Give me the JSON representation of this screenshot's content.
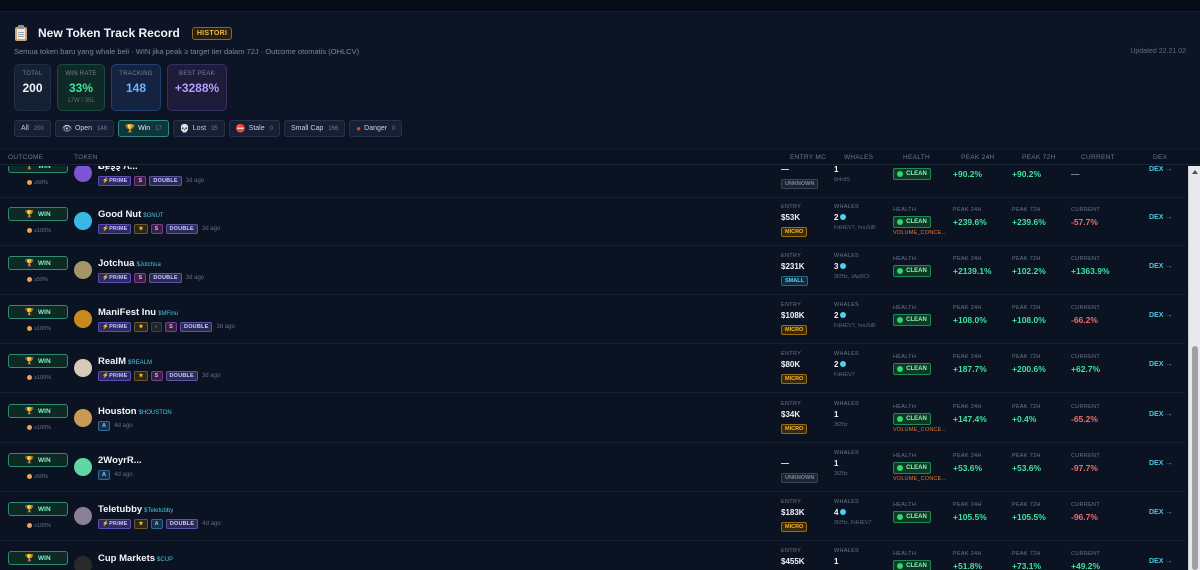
{
  "header": {
    "title": "New Token Track Record",
    "badge": "HISTORI",
    "subtitle": "Semua token baru yang whale beli · WIN jika peak ≥ target tier dalam 72J · Outcome otomatis (OHLCV)",
    "updated": "Updated 22.21.02"
  },
  "stats": {
    "total": {
      "label": "TOTAL",
      "value": "200"
    },
    "win_rate": {
      "label": "WIN RATE",
      "value": "33%",
      "sub": "17W / 35L"
    },
    "tracking": {
      "label": "TRACKING",
      "value": "148"
    },
    "best_peak": {
      "label": "BEST PEAK",
      "value": "+3288%"
    }
  },
  "filters": [
    {
      "label": "All",
      "count": "200",
      "icon": ""
    },
    {
      "label": "Open",
      "count": "148",
      "icon": "eye-icon"
    },
    {
      "label": "Win",
      "count": "17",
      "icon": "trophy-icon"
    },
    {
      "label": "Lost",
      "count": "35",
      "icon": "skull-icon"
    },
    {
      "label": "Stale",
      "count": "0",
      "icon": "no-entry-icon"
    },
    {
      "label": "Small Cap",
      "count": "166",
      "icon": ""
    },
    {
      "label": "Danger",
      "count": "0",
      "icon": "red-circle-icon"
    }
  ],
  "columns": {
    "outcome": "OUTCOME",
    "token": "TOKEN",
    "entry_mc": "ENTRY MC",
    "whales": "WHALES",
    "health": "HEALTH",
    "peak24": "PEAK 24H",
    "peak72": "PEAK 72H",
    "current": "CURRENT",
    "dex": "DEX"
  },
  "labels": {
    "entry": "ENTRY",
    "whales": "WHALES",
    "health": "HEALTH",
    "peak24": "PEAK 24H",
    "peak72": "PEAK 72H",
    "current": "CURRENT",
    "win": "WIN",
    "clean": "CLEAN",
    "dex": "DEX →"
  },
  "colors": {
    "accent": "#4bc6e0",
    "positive": "#3fe39f",
    "negative": "#f06b6b",
    "micro": "#f2b33a"
  },
  "rows": [
    {
      "outcome": "WIN",
      "pct": "≥50%",
      "name": "Ƀɇȿȿ Ʌ...",
      "symbol": "",
      "tags": [
        "PRIME",
        "S",
        "DOUBLE"
      ],
      "ago": "3d ago",
      "entry": "—",
      "size": "UNKNOWN",
      "whales": "1",
      "addrs": "8i4rdS",
      "vol": "",
      "peak24": "+90.2%",
      "peak72": "+90.2%",
      "current": "—",
      "avatar": "#7b55d6"
    },
    {
      "outcome": "WIN",
      "pct": "≥100%",
      "name": "Good Nut",
      "symbol": "$GNUT",
      "tags": [
        "PRIME",
        "★",
        "S",
        "DOUBLE"
      ],
      "ago": "3d ago",
      "entry": "$53K",
      "size": "MICRO",
      "whales": "2",
      "addrs": "FdHEV7, hnuSiB",
      "vol": "VOLUME_CONCE...",
      "peak24": "+239.6%",
      "peak72": "+239.6%",
      "current": "-57.7%",
      "avatar": "#39b8e6"
    },
    {
      "outcome": "WIN",
      "pct": "≥50%",
      "name": "Jotchua",
      "symbol": "$Jotchua",
      "tags": [
        "PRIME",
        "S",
        "DOUBLE"
      ],
      "ago": "3d ago",
      "entry": "$231K",
      "size": "SMALL",
      "whales": "3",
      "addrs": "3fZftz, JApBCt",
      "vol": "",
      "peak24": "+2139.1%",
      "peak72": "+102.2%",
      "current": "+1363.9%",
      "avatar": "#a5946a"
    },
    {
      "outcome": "WIN",
      "pct": "≥100%",
      "name": "ManiFest Inu",
      "symbol": "$MFinu",
      "tags": [
        "PRIME",
        "★",
        "pill",
        "S",
        "DOUBLE"
      ],
      "ago": "3d ago",
      "entry": "$108K",
      "size": "MICRO",
      "whales": "2",
      "addrs": "FdHEV7, hnuSiB",
      "vol": "",
      "peak24": "+108.0%",
      "peak72": "+108.0%",
      "current": "-66.2%",
      "avatar": "#c8891e"
    },
    {
      "outcome": "WIN",
      "pct": "≥100%",
      "name": "RealM",
      "symbol": "$REALM",
      "tags": [
        "PRIME",
        "★",
        "S",
        "DOUBLE"
      ],
      "ago": "3d ago",
      "entry": "$80K",
      "size": "MICRO",
      "whales": "2",
      "addrs": "FdHEV7",
      "vol": "",
      "peak24": "+187.7%",
      "peak72": "+200.6%",
      "current": "+62.7%",
      "avatar": "#d9c9b8"
    },
    {
      "outcome": "WIN",
      "pct": "≥100%",
      "name": "Houston",
      "symbol": "$HOUSTON",
      "tags": [
        "A"
      ],
      "ago": "4d ago",
      "entry": "$34K",
      "size": "MICRO",
      "whales": "1",
      "addrs": "3fZftz",
      "vol": "VOLUME_CONCE...",
      "peak24": "+147.4%",
      "peak72": "+0.4%",
      "current": "-65.2%",
      "avatar": "#c99a55"
    },
    {
      "outcome": "WIN",
      "pct": "≥50%",
      "name": "2WoyrR...",
      "symbol": "",
      "tags": [
        "A"
      ],
      "ago": "4d ago",
      "entry": "—",
      "size": "UNKNOWN",
      "whales": "1",
      "addrs": "3fZftz",
      "vol": "VOLUME_CONCE...",
      "peak24": "+53.6%",
      "peak72": "+53.6%",
      "current": "-97.7%",
      "avatar": "#5fd6a3"
    },
    {
      "outcome": "WIN",
      "pct": "≥100%",
      "name": "Teletubby",
      "symbol": "$Teletubby",
      "tags": [
        "PRIME",
        "★",
        "A",
        "DOUBLE"
      ],
      "ago": "4d ago",
      "entry": "$183K",
      "size": "MICRO",
      "whales": "4",
      "addrs": "3fZftz, FdHEV7",
      "vol": "",
      "peak24": "+105.5%",
      "peak72": "+105.5%",
      "current": "-96.7%",
      "avatar": "#8a7f96"
    },
    {
      "outcome": "WIN",
      "pct": "",
      "name": "Cup Markets",
      "symbol": "$CUP",
      "tags": [],
      "ago": "",
      "entry": "$455K",
      "size": "",
      "whales": "1",
      "addrs": "",
      "vol": "",
      "peak24": "+51.8%",
      "peak72": "+73.1%",
      "current": "+49.2%",
      "avatar": "#2b2a2a"
    }
  ]
}
